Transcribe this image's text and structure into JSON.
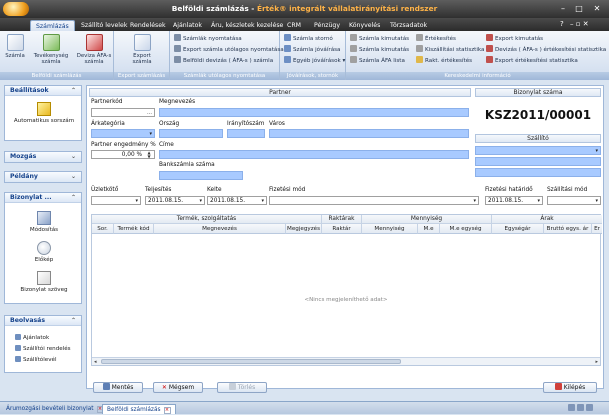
{
  "window": {
    "title_part1": "Belföldi számlázás",
    "title_sep": " - ",
    "title_part2": "Érték® integrált vállalatirányítási rendszer",
    "minimize": "–",
    "maximize": "□",
    "close": "✕"
  },
  "menu": {
    "tabs": [
      "Számlázás",
      "Szállító levelek",
      "Rendelések",
      "Ajánlatok",
      "Áru, készletek kezelése",
      "CRM",
      "Pénzügy",
      "Könyvelés",
      "Törzsadatok"
    ],
    "help": "?",
    "controls": "–  ▫  ✕"
  },
  "ribbon": {
    "group1": {
      "label": "Belföldi számlázás",
      "buttons": [
        "Számla",
        "Tevékenység számla",
        "Deviza ÁFA-s számla"
      ]
    },
    "group2": {
      "label": "Export számlázás",
      "buttons": [
        "Export számla"
      ]
    },
    "group3": {
      "label": "Számlák utólagos nyomtatása",
      "items": [
        "Számlák nyomtatása",
        "Export számla utólagos nyomtatása",
        "Belföldi devizás ( ÁFA-s ) számla"
      ]
    },
    "group4": {
      "label": "Jóváírások, stornók",
      "items": [
        "Számla stornó",
        "Számla jóváírása",
        "Egyéb jóváírások"
      ]
    },
    "group5": {
      "label": "Kereskedelmi információ",
      "items": [
        "Számla kimutatás",
        "Számla kimutatás",
        "Számla ÁFA lista",
        "Értékesítés",
        "Kiszállítási statisztika",
        "Rakt. értékesítés",
        "Export kimutatás",
        "Devizás ( ÁFA-s ) értékesítési statisztika",
        "Export értékesítési statisztika"
      ]
    }
  },
  "leftnav": {
    "beallitasok": {
      "title": "Beállítások",
      "items": [
        "Automatikus sorszám"
      ]
    },
    "mozgas": {
      "title": "Mozgás"
    },
    "peldany": {
      "title": "Példány"
    },
    "bizonylat": {
      "title": "Bizonylat ...",
      "items": [
        "Módosítás",
        "Előkép",
        "Bizonylat szöveg"
      ]
    },
    "beolvasas": {
      "title": "Beolvasás",
      "items": [
        "Ajánlatok",
        "Szállítói rendelés",
        "Szállítólevél"
      ]
    }
  },
  "partner": {
    "header": "Partner",
    "partnerkod_label": "Partnerkód",
    "megnevezes_label": "Megnevezés",
    "arkategoria_label": "Árkategória",
    "orszag_label": "Ország",
    "iranyitoszam_label": "Irányítószám",
    "varos_label": "Város",
    "engedmeny_label": "Partner engedmény %",
    "engedmeny_value": "0,00 %",
    "cime_label": "Címe",
    "bankszamla_label": "Bankszámla száma"
  },
  "bizonylat": {
    "header": "Bizonylat száma",
    "number": "KSZ2011/00001",
    "szallito_header": "Szállító"
  },
  "row2": {
    "uzletkoto_label": "Üzletkötő",
    "teljesites_label": "Teljesítés",
    "teljesites_value": "2011.08.15.",
    "kelte_label": "Kelte",
    "kelte_value": "2011.08.15.",
    "fizetesi_mod_label": "Fizetési mód",
    "fizetesi_hatarido_label": "Fizetési határidő",
    "fizetesi_hatarido_value": "2011.08.15.",
    "szallitasi_mod_label": "Szállítási mód"
  },
  "grid": {
    "groups": [
      "Termék, szolgáltatás",
      "Raktárak",
      "Mennyiség",
      "Árak"
    ],
    "columns": [
      "Sor.",
      "Termék kód",
      "Megnevezés",
      "Megjegyzés",
      "Raktár",
      "Mennyiség",
      "M.e",
      "M.e egység",
      "Egységár",
      "Bruttó egys. ár",
      "Er"
    ],
    "empty_text": "<Nincs megjeleníthető adat>"
  },
  "buttons": {
    "save": "Mentés",
    "cancel": "Mégsem",
    "delete": "Törlés",
    "exit": "Kilépés"
  },
  "statusbar": {
    "tabs": [
      "Árumozgási bevételi bizonylat",
      "Belföldi számlázás"
    ]
  }
}
